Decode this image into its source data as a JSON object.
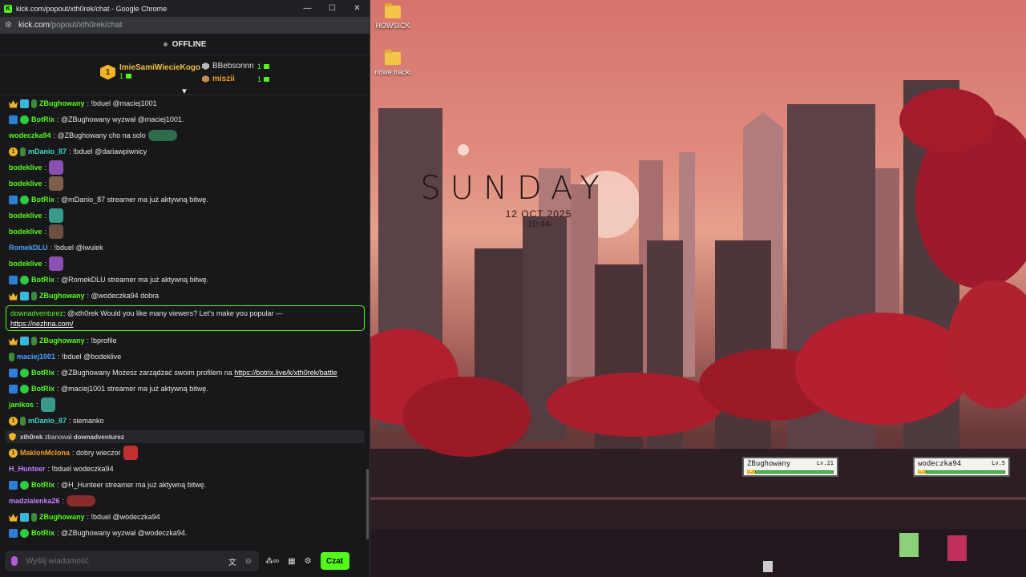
{
  "window": {
    "title": "kick.com/popout/xth0rek/chat - Google Chrome",
    "favicon": "K",
    "controls": {
      "minimize": "—",
      "maximize": "☐",
      "close": "✕"
    },
    "url_host": "kick.com",
    "url_path": "/popout/xth0rek/chat"
  },
  "chat_header": {
    "status": "OFFLINE",
    "leaderboard": {
      "first": {
        "rank": "1",
        "name": "ImieSamiWiecieKogo",
        "count": "1"
      },
      "second": {
        "name": "BBebsonnn",
        "count": "1"
      },
      "third": {
        "name": "miszii",
        "count": "1"
      }
    },
    "collapse_icon": "▼"
  },
  "messages": [
    {
      "user": "ZBughowany",
      "color": "#53fc18",
      "text": ": !bduel @maciej1001",
      "badges": [
        "crown",
        "grid",
        "sub"
      ]
    },
    {
      "user": "BotRix",
      "color": "#53fc18",
      "text": ": @ZBughowany wyzwał @maciej1001.",
      "badges": [
        "bot",
        "ver"
      ]
    },
    {
      "user": "wodeczka94",
      "color": "#53fc18",
      "text": ": @ZBughowany cho na solo",
      "badges": [],
      "emote": "#2e6b4c",
      "emote_wide": true
    },
    {
      "user": "mDanio_87",
      "color": "#38d9c9",
      "text": ": !bduel @dariawpiwnicy",
      "badges": [
        "one",
        "sub"
      ]
    },
    {
      "user": "bodeklive",
      "color": "#53fc18",
      "text": ":",
      "badges": [],
      "emote": "#8a4fb0"
    },
    {
      "user": "bodeklive",
      "color": "#53fc18",
      "text": ":",
      "badges": [],
      "emote": "#7a6048"
    },
    {
      "user": "BotRix",
      "color": "#53fc18",
      "text": ": @mDanio_87 streamer ma już aktywną bitwę.",
      "badges": [
        "bot",
        "ver"
      ]
    },
    {
      "user": "bodeklive",
      "color": "#53fc18",
      "text": ":",
      "badges": [],
      "emote": "#3a9a8a"
    },
    {
      "user": "bodeklive",
      "color": "#53fc18",
      "text": ":",
      "badges": [],
      "emote": "#6a5040"
    },
    {
      "user": "RomekDLU",
      "color": "#4aa3ff",
      "text": ": !bduel @iwulek",
      "badges": []
    },
    {
      "user": "bodeklive",
      "color": "#53fc18",
      "text": ":",
      "badges": [],
      "emote": "#8a4fb0"
    },
    {
      "user": "BotRix",
      "color": "#53fc18",
      "text": ": @RomekDLU streamer ma już aktywną bitwę.",
      "badges": [
        "bot",
        "ver"
      ]
    },
    {
      "user": "ZBughowany",
      "color": "#53fc18",
      "text": ": @wodeczka94 dobra",
      "badges": [
        "crown",
        "grid",
        "sub"
      ]
    }
  ],
  "highlight": {
    "user": "downadventurez",
    "text": ": @xth0rek Would you like many viewers? Let's make you popular —",
    "link": "https://nezhna.com/"
  },
  "messages2": [
    {
      "user": "ZBughowany",
      "color": "#53fc18",
      "text": ": !bprofile",
      "badges": [
        "crown",
        "grid",
        "sub"
      ]
    },
    {
      "user": "maciej1001",
      "color": "#4aa3ff",
      "text": ": !bduel @bodeklive",
      "badges": [
        "sub"
      ]
    }
  ],
  "botrix_profile": {
    "user": "BotRix",
    "text": ": @ZBughowany Możesz zarządzać swoim profilem na ",
    "link": "https://botrix.live/k/xth0rek/battle"
  },
  "messages3": [
    {
      "user": "BotRix",
      "color": "#53fc18",
      "text": ": @maciej1001 streamer ma już aktywną bitwę.",
      "badges": [
        "bot",
        "ver"
      ]
    },
    {
      "user": "janikos",
      "color": "#53fc18",
      "text": ":",
      "badges": [],
      "emote": "#3a9a8a"
    },
    {
      "user": "mDanio_87",
      "color": "#38d9c9",
      "text": ": siemanko",
      "badges": [
        "one",
        "sub"
      ]
    }
  ],
  "ban_notice": {
    "moderator": "xth0rek",
    "action": "zbanował",
    "target": "downadventurez"
  },
  "messages4": [
    {
      "user": "MaklonMclona",
      "color": "#f0a020",
      "text": ": dobry wieczor",
      "badges": [
        "one"
      ],
      "emote": "#c03030"
    },
    {
      "user": "H_Hunteer",
      "color": "#c77dff",
      "text": ": !bduel wodeczka94",
      "badges": []
    },
    {
      "user": "BotRix",
      "color": "#53fc18",
      "text": ": @H_Hunteer streamer ma już aktywną bitwę.",
      "badges": [
        "bot",
        "ver"
      ]
    },
    {
      "user": "madzialenka26",
      "color": "#c77dff",
      "text": ":",
      "badges": [],
      "emote": "#8a2a2a",
      "emote_wide": true
    },
    {
      "user": "ZBughowany",
      "color": "#53fc18",
      "text": ": !bduel @wodeczka94",
      "badges": [
        "crown",
        "grid",
        "sub"
      ]
    },
    {
      "user": "BotRix",
      "color": "#53fc18",
      "text": ": @ZBughowany wyzwał @wodeczka94.",
      "badges": [
        "bot",
        "ver"
      ]
    }
  ],
  "composer": {
    "placeholder": "Wyślij wiadomość",
    "send_label": "Czat"
  },
  "desktop": {
    "icons": [
      {
        "label": "HOWSICK"
      },
      {
        "label": "nowe tracki"
      }
    ],
    "clock": {
      "day": "SUNDAY",
      "date": "12 OCT 2025",
      "time": "-10:44-"
    },
    "battle": [
      {
        "name": "ZBughowany",
        "level": "Lv.21",
        "hp": "HP"
      },
      {
        "name": "wodeczka94",
        "level": "Lv.5",
        "hp": "HP"
      }
    ]
  },
  "colors": {
    "accent": "#53fc18",
    "background": "#18181b"
  }
}
